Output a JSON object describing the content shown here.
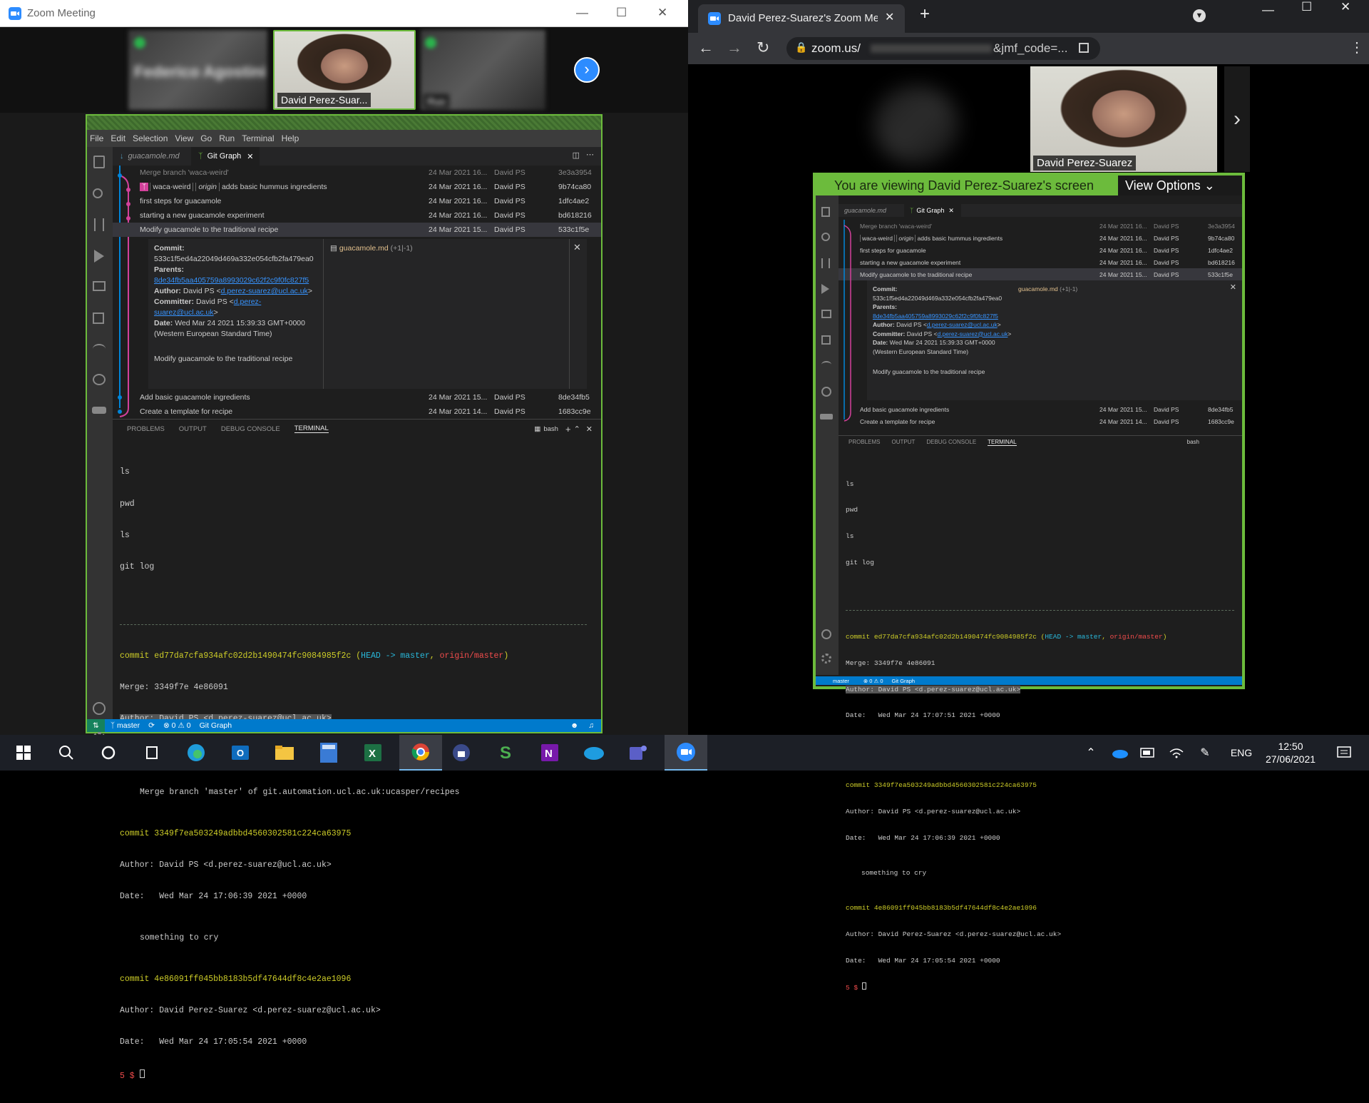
{
  "left_window": {
    "title": "Zoom Meeting",
    "participants": [
      {
        "name": "Federico Agostini"
      },
      {
        "name": "David Perez-Suar..."
      },
      {
        "name": "Ruo"
      }
    ]
  },
  "vscode": {
    "menu": [
      "File",
      "Edit",
      "Selection",
      "View",
      "Go",
      "Run",
      "Terminal",
      "Help"
    ],
    "tabs": [
      {
        "label": "guacamole.md"
      },
      {
        "label": "Git Graph"
      }
    ],
    "commits": [
      {
        "msg": "Merge branch 'waca-weird'",
        "date": "24 Mar 2021 16...",
        "author": "David PS",
        "hash": "3e3a3954"
      },
      {
        "branch": "waca-weird",
        "remote": "origin",
        "msg": "adds basic hummus ingredients",
        "date": "24 Mar 2021 16...",
        "author": "David PS",
        "hash": "9b74ca80"
      },
      {
        "msg": "first steps for guacamole",
        "date": "24 Mar 2021 16...",
        "author": "David PS",
        "hash": "1dfc4ae2"
      },
      {
        "msg": "starting a new guacamole experiment",
        "date": "24 Mar 2021 16...",
        "author": "David PS",
        "hash": "bd618216"
      },
      {
        "msg": "Modify guacamole to the traditional recipe",
        "date": "24 Mar 2021 15...",
        "author": "David PS",
        "hash": "533c1f5e"
      }
    ],
    "commits_after": [
      {
        "msg": "Add basic guacamole ingredients",
        "date": "24 Mar 2021 15...",
        "author": "David PS",
        "hash": "8de34fb5"
      },
      {
        "msg": "Create a template for recipe",
        "date": "24 Mar 2021 14...",
        "author": "David PS",
        "hash": "1683cc9e"
      }
    ],
    "details": {
      "commit_label": "Commit:",
      "commit": "533c1f5ed4a22049d469a332e054cfb2fa479ea0",
      "parents_label": "Parents:",
      "parents": "8de34fb5aa405759a8993029c62f2c9f0fc827f5",
      "author_label": "Author:",
      "author": "David PS",
      "author_email": "d.perez-suarez@ucl.ac.uk",
      "committer_label": "Committer:",
      "committer": "David PS",
      "committer_email": "d.perez-suarez@ucl.ac.uk",
      "date_label": "Date:",
      "date": "Wed Mar 24 2021 15:39:33 GMT+0000 (Western European Standard Time)",
      "message": "Modify guacamole to the traditional recipe",
      "file": "guacamole.md",
      "file_stats": "(+1|-1)"
    },
    "panel_tabs": [
      "PROBLEMS",
      "OUTPUT",
      "DEBUG CONSOLE",
      "TERMINAL"
    ],
    "shell": "bash",
    "history": [
      "ls",
      "pwd",
      "ls",
      "git log"
    ],
    "log": [
      {
        "hash": "commit ed77da7cfa934afc02d2b1490474fc9084985f2c",
        "refs_head": "HEAD -> master",
        "refs_origin": "origin/master",
        "merge": "Merge: 3349f7e 4e86091",
        "author": "Author: David PS <d.perez-suarez@ucl.ac.uk>",
        "date": "Date:   Wed Mar 24 17:07:51 2021 +0000",
        "message": "Merge branch 'master' of git.automation.ucl.ac.uk:ucasper/recipes"
      },
      {
        "hash": "commit 3349f7ea503249adbbd4560302581c224ca63975",
        "author": "Author: David PS <d.perez-suarez@ucl.ac.uk>",
        "date": "Date:   Wed Mar 24 17:06:39 2021 +0000",
        "message": "something to cry"
      },
      {
        "hash": "commit 4e86091ff045bb8183b5df47644df8c4e2ae1096",
        "author": "Author: David Perez-Suarez <d.perez-suarez@ucl.ac.uk>",
        "date": "Date:   Wed Mar 24 17:05:54 2021 +0000"
      }
    ],
    "prompt": "5 $",
    "status": {
      "branch": "master",
      "errors": "0",
      "warnings": "0",
      "ext": "Git Graph"
    }
  },
  "chrome": {
    "tab_title": "David Perez-Suarez's Zoom Meeti",
    "url": "zoom.us/",
    "url_tail": "&jmf_code=...",
    "presenter": "David Perez-Suarez",
    "share_banner": "You are viewing David Perez-Suarez's screen",
    "view_options": "View Options"
  },
  "taskbar": {
    "lang": "ENG",
    "time": "12:50",
    "date": "27/06/2021"
  }
}
